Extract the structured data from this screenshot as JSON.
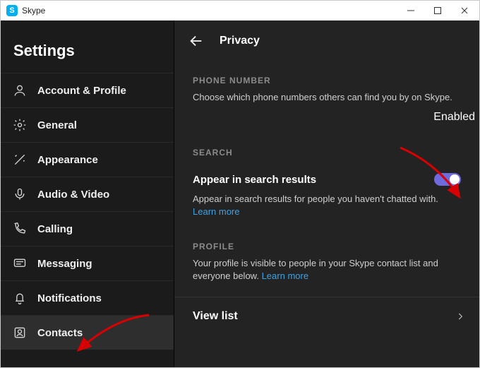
{
  "window": {
    "title": "Skype"
  },
  "sidebar": {
    "header": "Settings",
    "items": [
      {
        "label": "Account & Profile"
      },
      {
        "label": "General"
      },
      {
        "label": "Appearance"
      },
      {
        "label": "Audio & Video"
      },
      {
        "label": "Calling"
      },
      {
        "label": "Messaging"
      },
      {
        "label": "Notifications"
      },
      {
        "label": "Contacts"
      }
    ]
  },
  "main": {
    "title": "Privacy",
    "phone": {
      "section_label": "PHONE NUMBER",
      "description": "Choose which phone numbers others can find you by on Skype.",
      "status": "Enabled"
    },
    "search": {
      "section_label": "SEARCH",
      "row_title": "Appear in search results",
      "description": "Appear in search results for people you haven't chatted with.",
      "learn_more": "Learn more",
      "toggle_on": true
    },
    "profile": {
      "section_label": "PROFILE",
      "description": "Your profile is visible to people in your Skype contact list and everyone below.",
      "learn_more": "Learn more"
    },
    "view_list": {
      "label": "View list"
    }
  }
}
